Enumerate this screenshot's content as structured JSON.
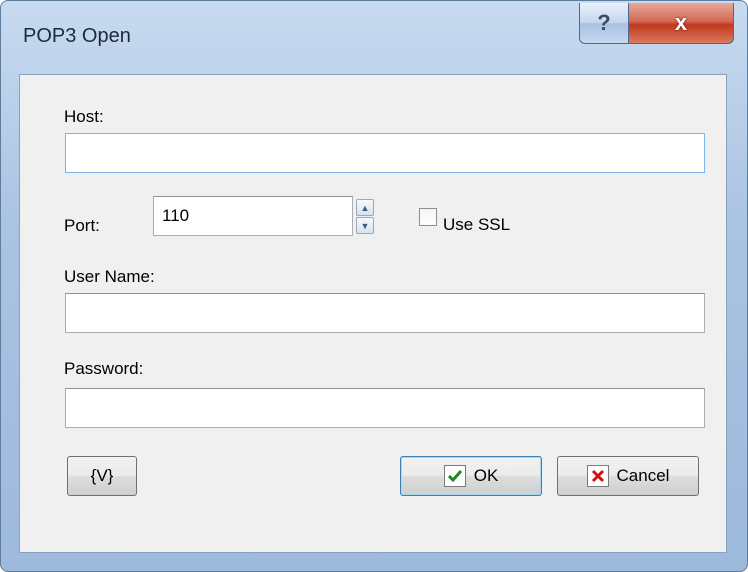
{
  "window": {
    "title": "POP3 Open",
    "help_glyph": "?",
    "close_glyph": "x"
  },
  "form": {
    "host": {
      "label": "Host:",
      "value": ""
    },
    "port": {
      "label": "Port:",
      "value": "110",
      "up_glyph": "▲",
      "down_glyph": "▼"
    },
    "use_ssl": {
      "label": "Use SSL",
      "checked": false
    },
    "user_name": {
      "label": "User Name:",
      "value": ""
    },
    "password": {
      "label": "Password:",
      "value": ""
    }
  },
  "buttons": {
    "variables": "{V}",
    "ok": "OK",
    "cancel": "Cancel"
  },
  "icons": {
    "ok_icon": "check-icon",
    "cancel_icon": "x-icon",
    "ok_icon_color": "#1a8a1a",
    "cancel_icon_color": "#d01010"
  }
}
